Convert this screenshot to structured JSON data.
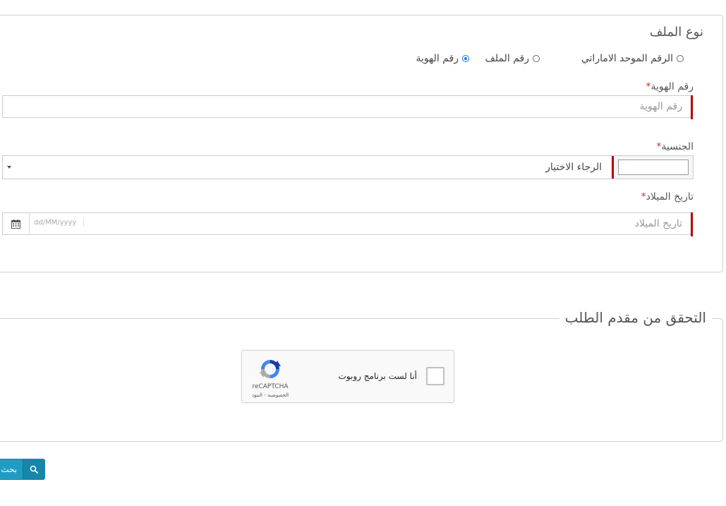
{
  "file_type": {
    "title": "نوع الملف",
    "options": [
      {
        "label": "الرقم الموحد الاماراتي",
        "checked": false
      },
      {
        "label": "رقم الملف",
        "checked": false
      },
      {
        "label": "رقم الهوية",
        "checked": true
      }
    ]
  },
  "id_number": {
    "label": "رقم الهوية",
    "required_mark": "*",
    "placeholder": "رقم الهوية"
  },
  "nationality": {
    "label": "الجنسية",
    "required_mark": "*",
    "selected": "الرجاء الاختيار"
  },
  "birth_date": {
    "label": "تاريخ الميلاد",
    "required_mark": "*",
    "placeholder": "تاريخ الميلاد",
    "format": "dd/MM/yyyy"
  },
  "verification": {
    "legend": "التحقق من مقدم الطلب",
    "recaptcha": {
      "checkbox_label": "أنا لست برنامج روبوت",
      "brand": "reCAPTCHA",
      "links": "الخصوصية - البنود"
    }
  },
  "search_button": {
    "label": "بحث"
  },
  "colors": {
    "required": "#b30000",
    "button": "#1f9cc4",
    "radio_checked": "#1a73e8"
  }
}
